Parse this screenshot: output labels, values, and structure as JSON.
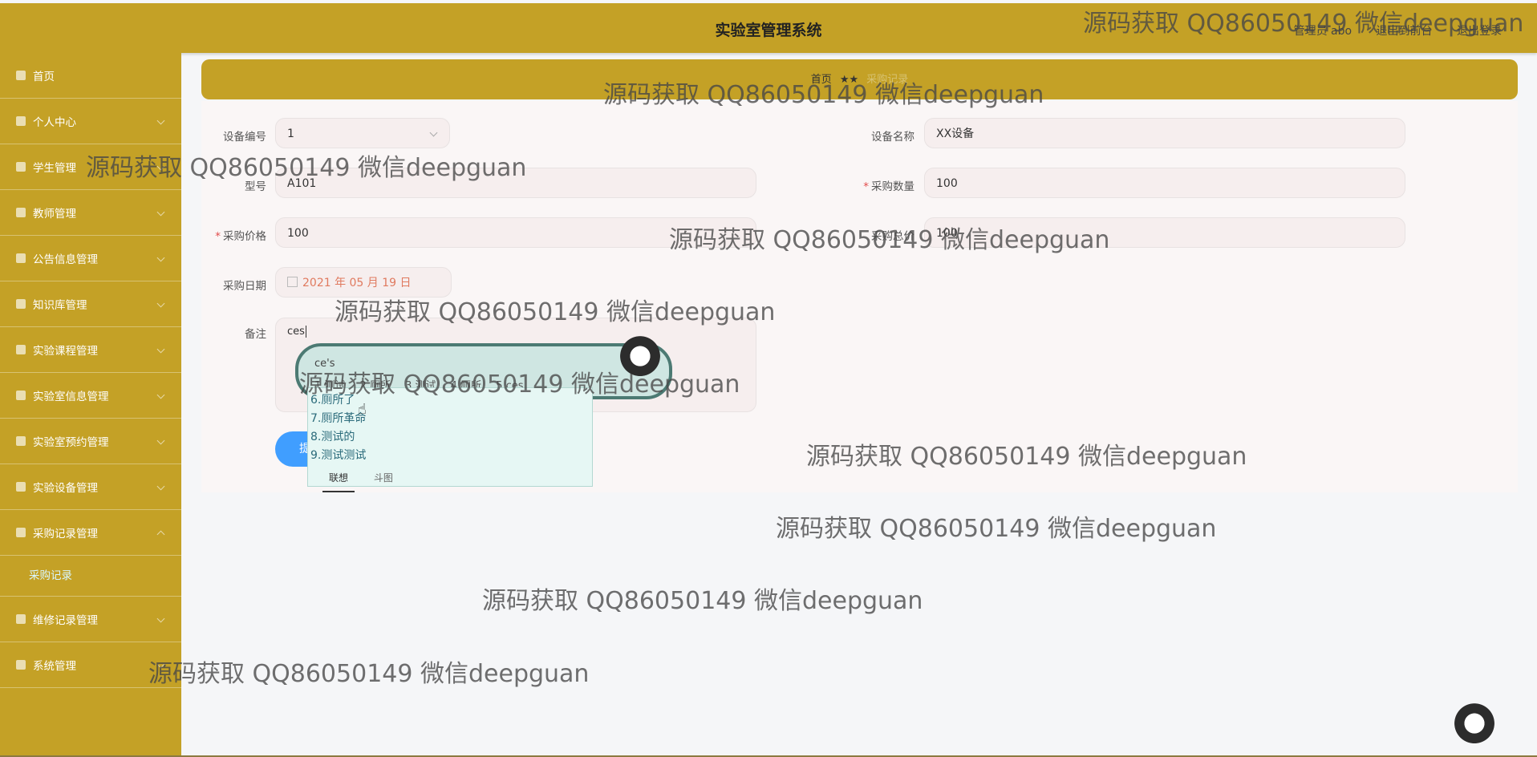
{
  "header": {
    "title": "实验室管理系统",
    "user_links": [
      "管理员 abo",
      "退出到前台",
      "退出登录"
    ]
  },
  "sidebar": {
    "items": [
      {
        "label": "首页",
        "icon": "home-icon"
      },
      {
        "label": "个人中心",
        "icon": "user-icon"
      },
      {
        "label": "学生管理",
        "icon": "list-icon"
      },
      {
        "label": "教师管理",
        "icon": "send-icon"
      },
      {
        "label": "公告信息管理",
        "icon": "mail-icon"
      },
      {
        "label": "知识库管理",
        "icon": "phone-icon"
      },
      {
        "label": "实验课程管理",
        "icon": "table-icon"
      },
      {
        "label": "实验室信息管理",
        "icon": "chart-icon"
      },
      {
        "label": "实验室预约管理",
        "icon": "person-icon"
      },
      {
        "label": "实验设备管理",
        "icon": "box-icon"
      },
      {
        "label": "采购记录管理",
        "icon": "pin-icon"
      },
      {
        "label": "维修记录管理",
        "icon": "user-icon"
      },
      {
        "label": "系统管理",
        "icon": "flag-icon"
      }
    ],
    "subitem": "采购记录"
  },
  "breadcrumb": {
    "home": "首页",
    "separator": "★★",
    "current": "采购记录"
  },
  "form": {
    "device_no_label": "设备编号",
    "device_no_value": "1",
    "device_name_label": "设备名称",
    "device_name_value": "XX设备",
    "model_label": "型号",
    "model_value": "A101",
    "qty_label": "采购数量",
    "qty_value": "100",
    "price_label": "采购价格",
    "price_value": "100",
    "total_label": "采购总价",
    "total_value": "100",
    "date_label": "采购日期",
    "date_value": "2021 年 05 月 19 日",
    "remark_label": "备注",
    "remark_value": "ces",
    "submit_label": "提交"
  },
  "ime": {
    "composition": "ce's",
    "row_candidates": [
      "1.测试",
      "2.厕所",
      "3.测试",
      "4.厕所",
      "5.ces"
    ],
    "list_candidates": [
      "6.厕所了",
      "7.厕所革命",
      "8.测试的",
      "9.测试测试"
    ],
    "tabs": [
      "联想",
      "斗图"
    ]
  },
  "watermark": "源码获取 QQ86050149 微信deepguan",
  "colors": {
    "header_bg": "#c4a126",
    "sidebar_bg": "#c4a126",
    "submit_bg": "#409eff"
  }
}
